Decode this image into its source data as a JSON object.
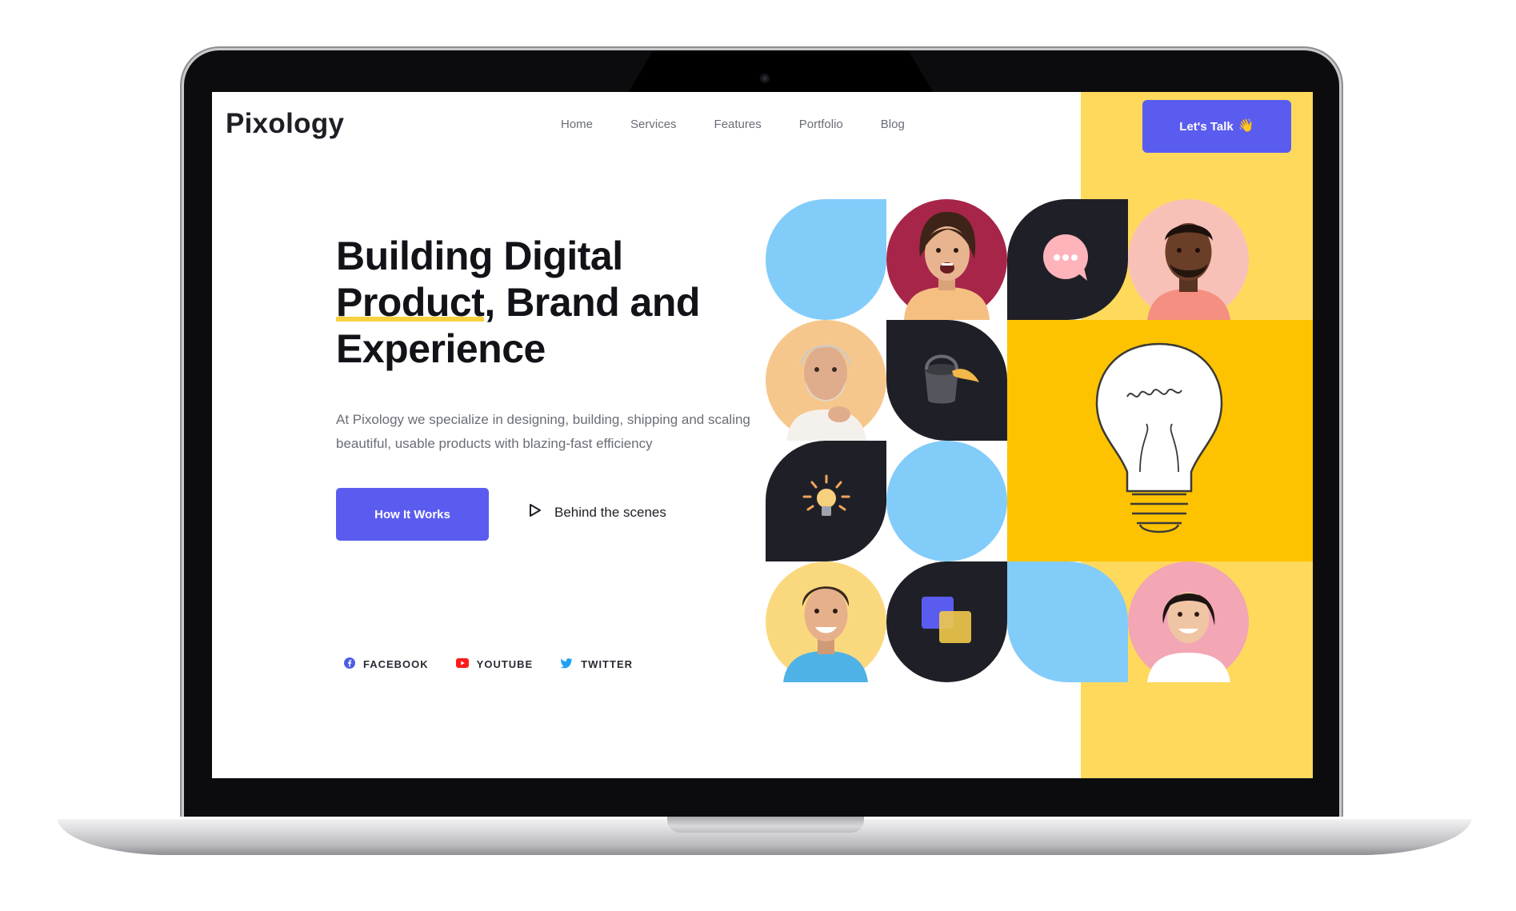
{
  "site": {
    "logo": "Pixology",
    "nav": [
      "Home",
      "Services",
      "Features",
      "Portfolio",
      "Blog"
    ],
    "cta_label": "Let's Talk",
    "cta_icon": "waving-hand-icon"
  },
  "hero": {
    "title_part1": "Building Digital",
    "title_underlined": "Product",
    "title_part2": ", Brand and",
    "title_part3": "Experience",
    "description": "At Pixology we specialize in designing, building, shipping and scaling beautiful, usable products with blazing-fast efficiency",
    "primary_button": "How It Works",
    "video_link": "Behind the scenes"
  },
  "socials": [
    {
      "label": "FACEBOOK",
      "icon": "facebook-icon"
    },
    {
      "label": "YOUTUBE",
      "icon": "youtube-icon"
    },
    {
      "label": "TWITTER",
      "icon": "twitter-icon"
    }
  ],
  "colors": {
    "accent": "#5a5cf0",
    "panel_yellow": "#fed95c",
    "bulb_block": "#fdc300",
    "tile_blue": "#82ccfa",
    "tile_dark": "#1f2027"
  }
}
